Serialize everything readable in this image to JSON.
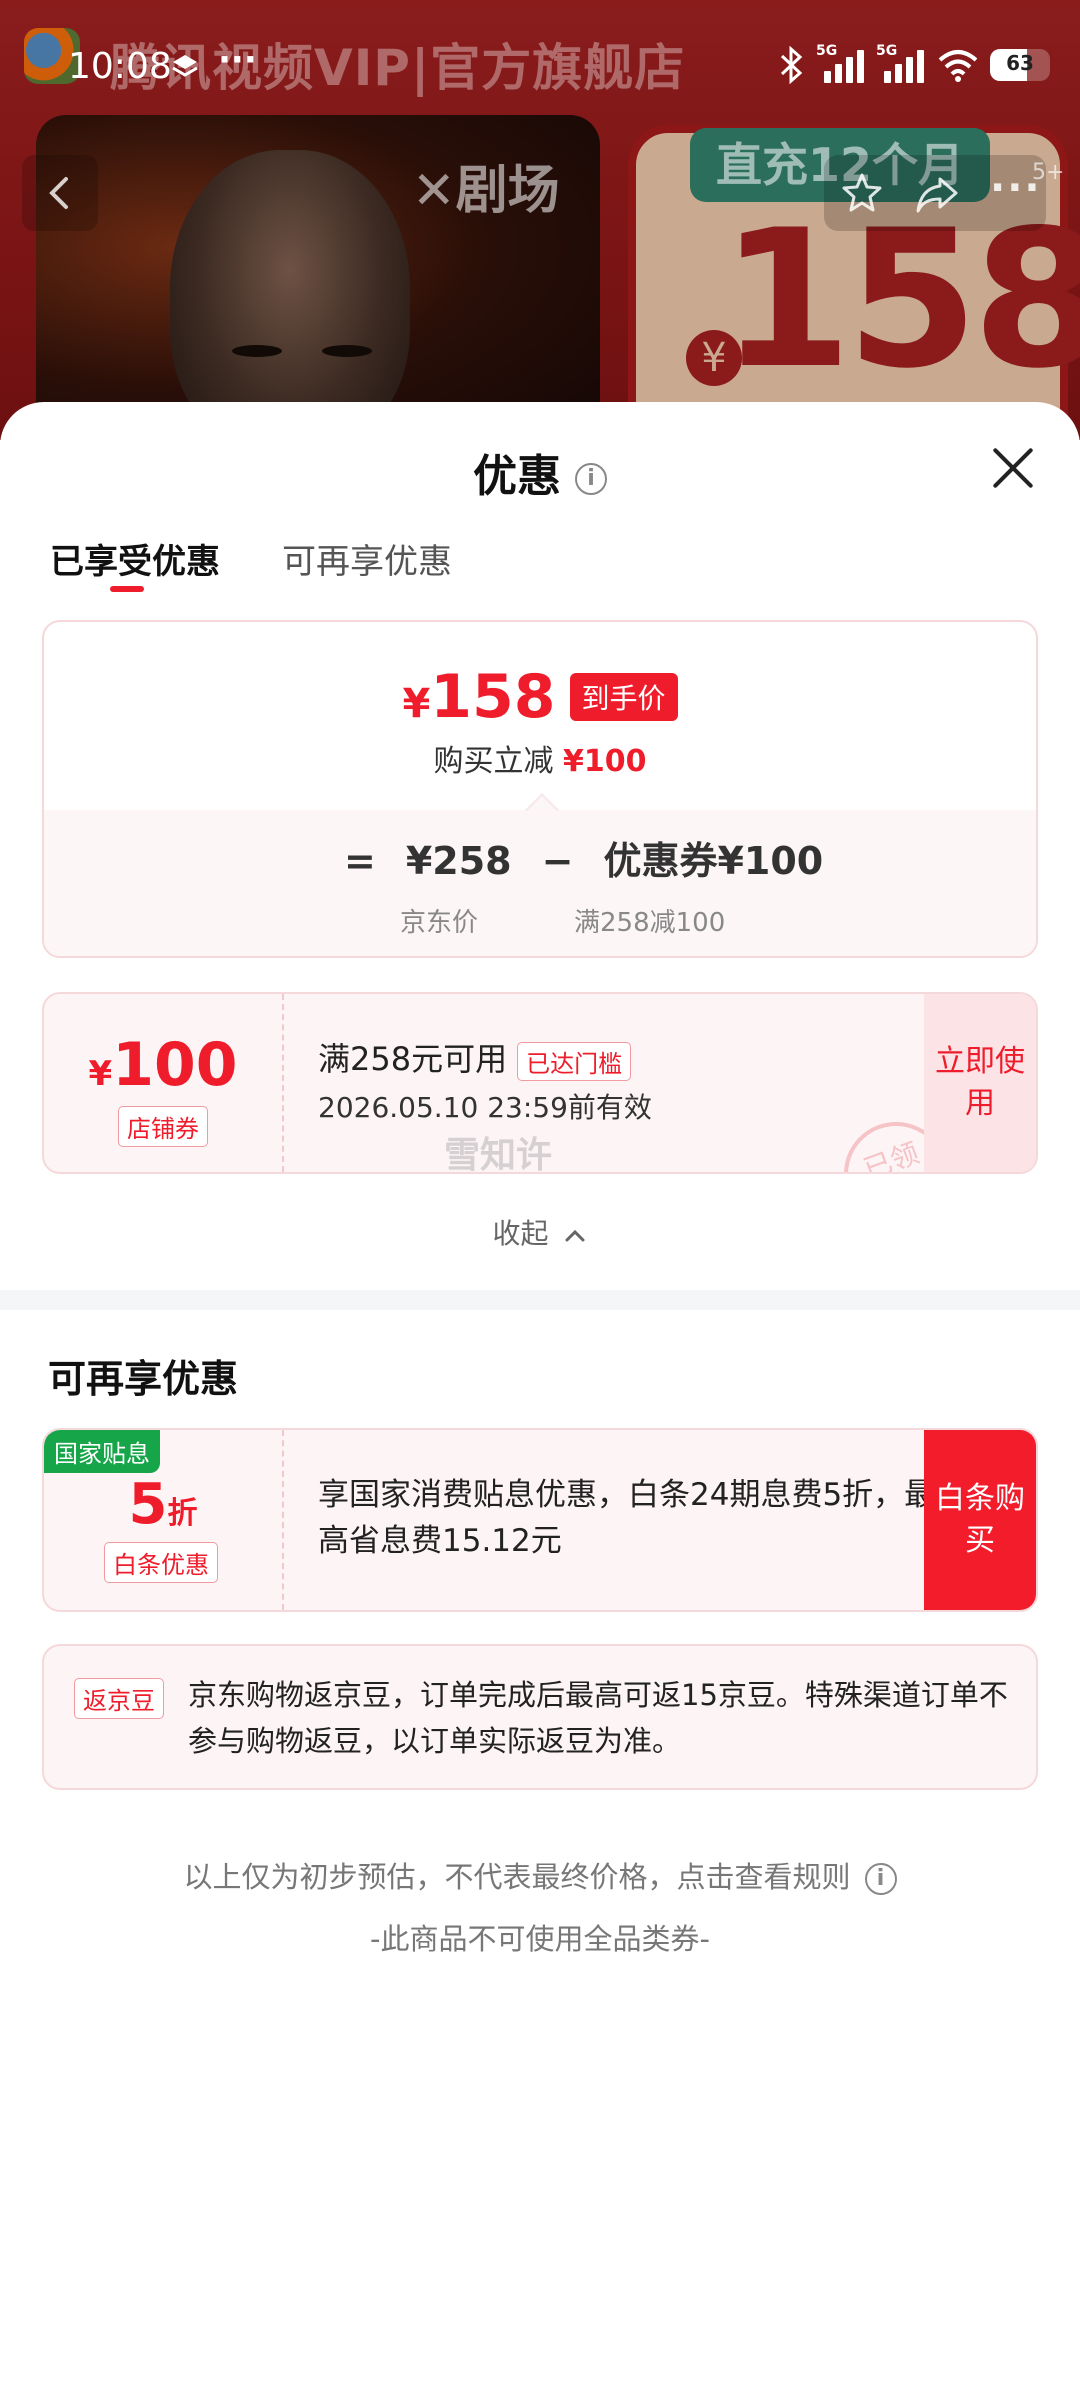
{
  "background": {
    "store_title": "腾讯视频VIP|官方旗舰店",
    "poster_brand": "剧场",
    "card_tag": "直充12个月",
    "card_price": "158",
    "card_currency": "¥",
    "badge": "5+"
  },
  "status_bar": {
    "time": "10:08",
    "battery": "63"
  },
  "sheet": {
    "title": "优惠",
    "tabs": [
      "已享受优惠",
      "可再享优惠"
    ]
  },
  "calc": {
    "price_symbol": "¥",
    "price": "158",
    "price_tag": "到手价",
    "sub_prefix": "购买立减",
    "sub_amount": "¥100",
    "eq": "=",
    "jd_price": "¥258",
    "minus": "−",
    "coupon_label": "优惠券¥100",
    "jd_price_label": "京东价",
    "coupon_cond": "满258减100"
  },
  "coupon": {
    "symbol": "¥",
    "amount": "100",
    "type": "店铺券",
    "condition": "满258元可用",
    "reached": "已达门槛",
    "expiry": "2026.05.10 23:59前有效",
    "stamp": "已领",
    "use": "立即使用"
  },
  "watermark": "雪知许",
  "collapse": "收起",
  "more_section": {
    "title": "可再享优惠",
    "subsidy": {
      "badge": "国家贴息",
      "num": "5",
      "unit": "折",
      "type": "白条优惠",
      "desc": "享国家消费贴息优惠，白条24期息费5折，最高省息费15.12元",
      "button": "白条购买"
    },
    "bean": {
      "tag": "返京豆",
      "text": "京东购物返京豆，订单完成后最高可返15京豆。特殊渠道订单不参与购物返豆，以订单实际返豆为准。"
    }
  },
  "footer": {
    "note": "以上仅为初步预估，不代表最终价格，点击查看规则",
    "no_coupon": "-此商品不可使用全品类券-"
  },
  "colors": {
    "accent": "#ef1d2b",
    "subsidy_green": "#16a548"
  }
}
